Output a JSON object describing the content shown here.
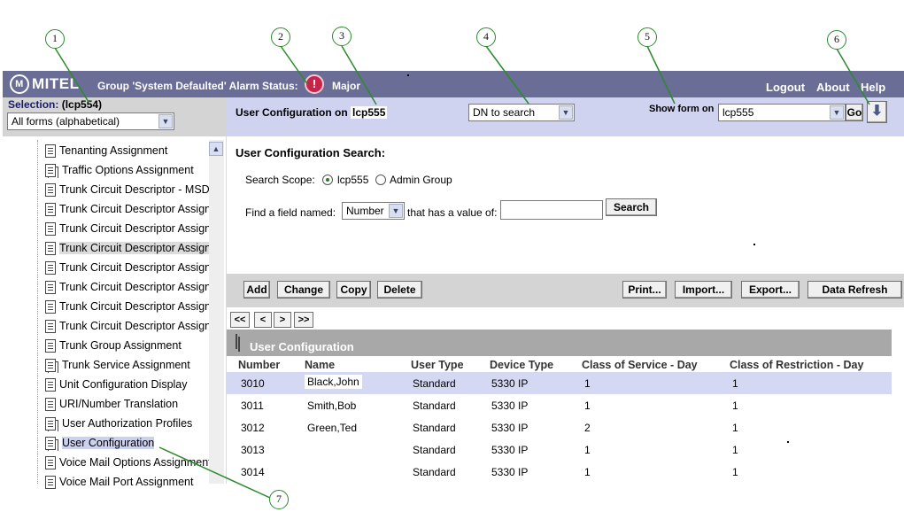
{
  "callouts": [
    "1",
    "2",
    "3",
    "4",
    "5",
    "6",
    "7"
  ],
  "header": {
    "logo_text": "MITEL",
    "group_text": "Group 'System Defaulted' Alarm Status:",
    "alarm_icon": "exclamation-icon",
    "alarm_symbol": "!",
    "alarm_level": "Major",
    "links": [
      "Logout",
      "About",
      "Help"
    ]
  },
  "selection": {
    "label": "Selection:",
    "system": "(lcp554)",
    "forms_select": "All forms (alphabetical)"
  },
  "tree": {
    "items": [
      {
        "label": "Tenanting Assignment",
        "icon": "document-icon"
      },
      {
        "label": "Traffic Options Assignment",
        "icon": "document-stack-icon"
      },
      {
        "label": "Trunk Circuit Descriptor - MSDN",
        "icon": "document-icon"
      },
      {
        "label": "Trunk Circuit Descriptor Assignment",
        "icon": "document-icon"
      },
      {
        "label": "Trunk Circuit Descriptor Assignment",
        "icon": "document-icon"
      },
      {
        "label": "Trunk Circuit Descriptor Assignment",
        "icon": "document-icon"
      },
      {
        "label": "Trunk Circuit Descriptor Assignment",
        "icon": "document-icon"
      },
      {
        "label": "Trunk Circuit Descriptor Assignment",
        "icon": "document-icon"
      },
      {
        "label": "Trunk Circuit Descriptor Assignment",
        "icon": "document-icon"
      },
      {
        "label": "Trunk Circuit Descriptor Assignment",
        "icon": "document-icon"
      },
      {
        "label": "Trunk Group Assignment",
        "icon": "document-icon"
      },
      {
        "label": "Trunk Service Assignment",
        "icon": "document-stack-icon"
      },
      {
        "label": "Unit Configuration Display",
        "icon": "document-icon"
      },
      {
        "label": "URI/Number Translation",
        "icon": "document-icon"
      },
      {
        "label": "User Authorization Profiles",
        "icon": "document-stack-icon"
      },
      {
        "label": "User Configuration",
        "icon": "document-stack-icon"
      },
      {
        "label": "Voice Mail Options Assignment",
        "icon": "document-icon"
      },
      {
        "label": "Voice Mail Port Assignment",
        "icon": "document-icon"
      }
    ]
  },
  "form_header": {
    "title": "User Configuration on",
    "system": "lcp555",
    "dn_select": "DN to search",
    "show_form_label": "Show form on",
    "show_form_select": "lcp555",
    "go_label": "Go",
    "download_icon": "down-arrow-icon"
  },
  "search": {
    "title": "User Configuration  Search:",
    "scope_label": "Search Scope:",
    "scope_options": [
      "lcp555",
      "Admin Group"
    ],
    "find_label": "Find a field named:",
    "field_select": "Number",
    "value_label": "that has a value of:",
    "value": "",
    "search_button": "Search"
  },
  "actions": {
    "left": [
      "Add",
      "Change",
      "Copy",
      "Delete"
    ],
    "right": [
      "Print...",
      "Import...",
      "Export...",
      "Data Refresh"
    ]
  },
  "pager": [
    "<<",
    "<",
    ">",
    ">>"
  ],
  "table": {
    "title": "User Configuration",
    "columns": [
      "Number",
      "Name",
      "User Type",
      "Device Type",
      "Class of Service - Day",
      "Class of Restriction - Day"
    ],
    "rows": [
      [
        "3010",
        "Black,John",
        "Standard",
        "5330 IP",
        "1",
        "1"
      ],
      [
        "3011",
        "Smith,Bob",
        "Standard",
        "5330 IP",
        "1",
        "1"
      ],
      [
        "3012",
        "Green,Ted",
        "Standard",
        "5330 IP",
        "2",
        "1"
      ],
      [
        "3013",
        "",
        "Standard",
        "5330 IP",
        "1",
        "1"
      ],
      [
        "3014",
        "",
        "Standard",
        "5330 IP",
        "1",
        "1"
      ]
    ]
  }
}
